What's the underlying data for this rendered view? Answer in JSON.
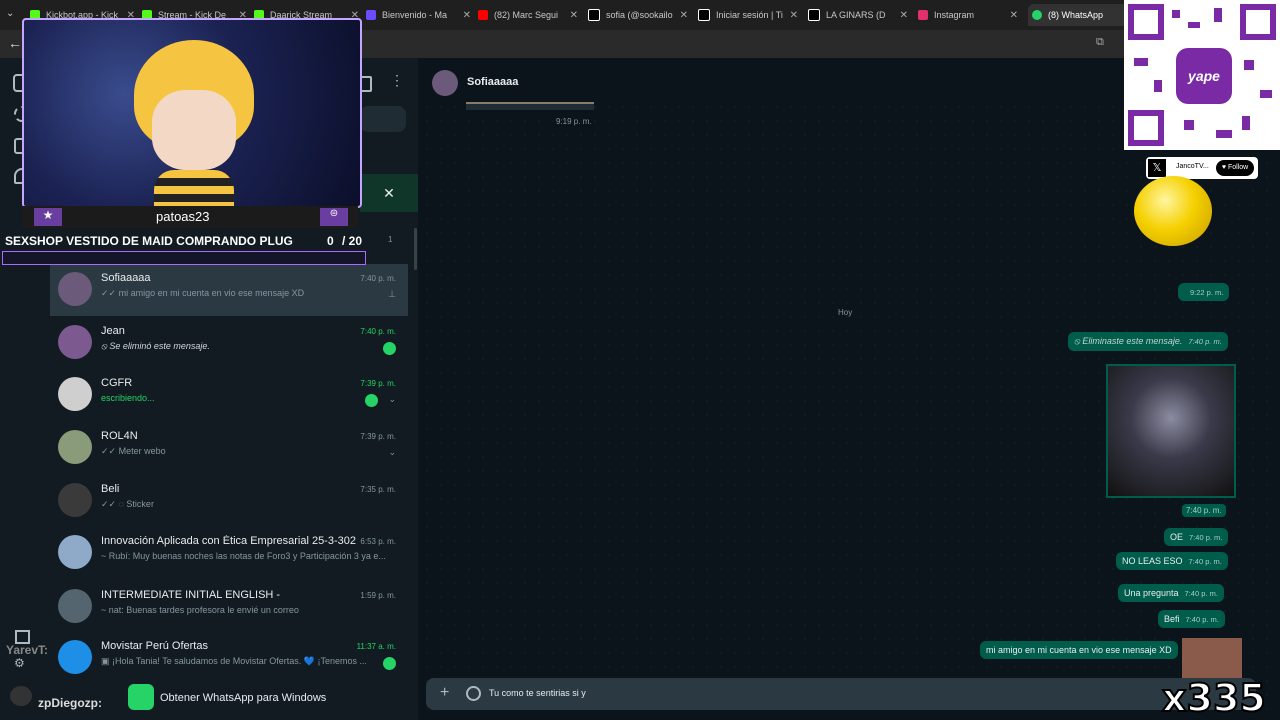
{
  "browser": {
    "tabs": [
      {
        "label": "Kickbot.app - Kick",
        "color": "#53fc18"
      },
      {
        "label": "Stream - Kick De",
        "color": "#53fc18"
      },
      {
        "label": "Daarick Stream",
        "color": "#53fc18"
      },
      {
        "label": "Bienvenido - Ma",
        "color": "#6d4cff"
      },
      {
        "label": "(82) Marc Segui",
        "color": "#ff0000"
      },
      {
        "label": "sofia (@sookailo",
        "color": "#ffffff"
      },
      {
        "label": "Iniciar sesión | Ti",
        "color": "#ffffff"
      },
      {
        "label": "LA GINARS (D",
        "color": "#ffffff"
      },
      {
        "label": "Instagram",
        "color": "#e1306c"
      },
      {
        "label": "(8) WhatsApp",
        "color": "#25d366"
      }
    ]
  },
  "stream_overlay": {
    "streamer": "patoas23",
    "goal_text": "SEXSHOP VESTIDO DE MAID COMPRANDO PLUG",
    "goal_count": "0",
    "goal_total": "/ 20",
    "subcount": "1",
    "chat_user_1": "YarevT:",
    "chat_user_2": "zpDiegozp:",
    "social_handle": "JancoTV...",
    "follow_label": "Follow",
    "counter": "x335",
    "qr_brand": "yape"
  },
  "chat_list": {
    "chats": [
      {
        "name": "Sofiaaaaa",
        "time": "7:40 p. m.",
        "preview": "✓✓ mi amigo en mi cuenta en vio ese mensaje XD",
        "pinned": true,
        "unread": false,
        "selected": true,
        "avatar_color": "#6b5a7a"
      },
      {
        "name": "Jean",
        "time": "7:40 p. m.",
        "preview": "⦸ Se eliminó este mensaje.",
        "unread": true,
        "avatar_color": "#7c5a8f"
      },
      {
        "name": "CGFR",
        "time": "7:39 p. m.",
        "preview": "escribiendo...",
        "typing": true,
        "unread": true,
        "avatar_color": "#cfcfcf"
      },
      {
        "name": "ROL4N",
        "time": "7:39 p. m.",
        "preview": "✓✓ Meter webo",
        "unread": false,
        "avatar_color": "#8a9b7a"
      },
      {
        "name": "Beli",
        "time": "7:35 p. m.",
        "preview": "✓✓ ◌ Sticker",
        "unread": false,
        "avatar_color": "#3a3a3a"
      },
      {
        "name": "Innovación Aplicada con Ética Empresarial  25-3-302...",
        "time": "6:53 p. m.",
        "preview": "~ Rubí: Muy buenas noches las notas de Foro3 y Participación 3 ya e...",
        "unread": false,
        "avatar_color": "#8fa9c9"
      },
      {
        "name": "INTERMEDIATE INITIAL ENGLISH -",
        "time": "1:59 p. m.",
        "preview": "~ nat: Buenas tardes profesora le envié un correo",
        "unread": false,
        "avatar_color": "#54656f"
      },
      {
        "name": "Movistar Perú Ofertas",
        "time": "11:37 a. m.",
        "preview": "▣ ¡Hola Tania! Te saludamos de Movistar Ofertas. 💙 ¡Tenemos ...",
        "unread": true,
        "avatar_color": "#1e8fe6"
      }
    ],
    "get_app_label": "Obtener WhatsApp para Windows"
  },
  "conversation": {
    "contact_name": "Sofiaaaaa",
    "first_time": "9:19 p. m.",
    "time_922": "9:22 p. m.",
    "day_label": "Hoy",
    "deleted_text": "Eliminaste este mensaje.",
    "deleted_time": "7:40 p. m.",
    "image_time": "7:40 p. m.",
    "messages": [
      {
        "text": "OE",
        "time": "7:40 p. m."
      },
      {
        "text": "NO LEAS ESO",
        "time": "7:40 p. m."
      },
      {
        "text": "Una pregunta",
        "time": "7:40 p. m."
      },
      {
        "text": "Befi",
        "time": "7:40 p. m."
      },
      {
        "text": "mi amigo en mi cuenta en vio ese mensaje XD",
        "time": ""
      }
    ],
    "composer_text": "Tu como te sentirias si y"
  },
  "colors": {
    "accent": "#25d366",
    "outgoing": "#005c4b",
    "panel": "#111b21"
  }
}
